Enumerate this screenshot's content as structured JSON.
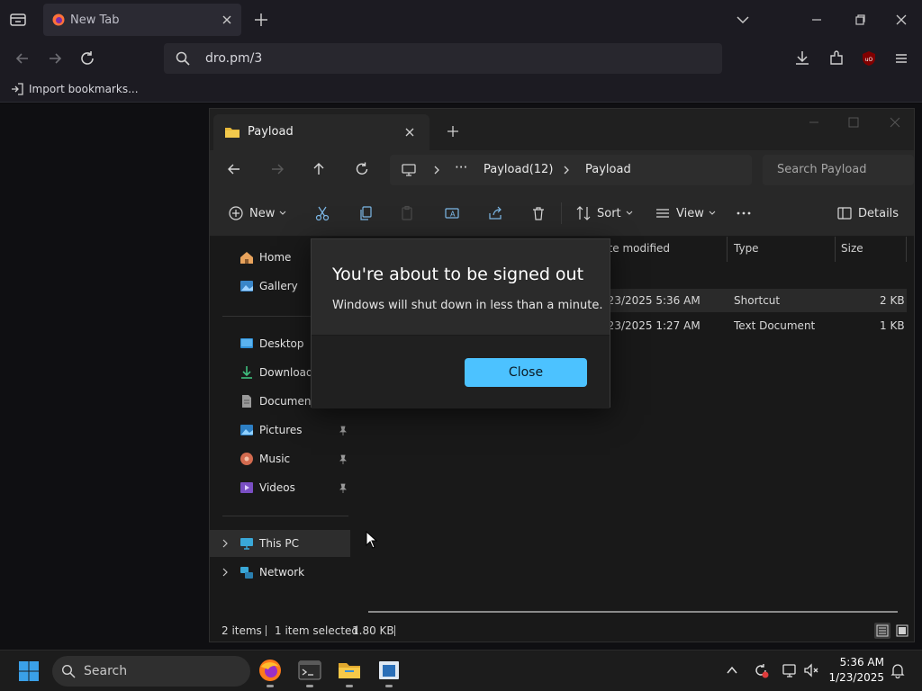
{
  "browser": {
    "tab_title": "New Tab",
    "url": "dro.pm/3",
    "bookmarks_import_label": "Import bookmarks..."
  },
  "explorer": {
    "tab_title": "Payload",
    "breadcrumbs": [
      "Payload(12)",
      "Payload"
    ],
    "search_placeholder": "Search Payload",
    "toolbar": {
      "new_label": "New",
      "sort_label": "Sort",
      "view_label": "View",
      "details_label": "Details"
    },
    "nav": {
      "home": "Home",
      "gallery": "Gallery",
      "desktop": "Desktop",
      "downloads": "Downloads",
      "documents": "Documents",
      "pictures": "Pictures",
      "music": "Music",
      "videos": "Videos",
      "this_pc": "This PC",
      "network": "Network"
    },
    "columns": {
      "date_modified": "Date modified",
      "type": "Type",
      "size": "Size"
    },
    "rows": [
      {
        "date": "1/23/2025 5:36 AM",
        "type": "Shortcut",
        "size": "2 KB"
      },
      {
        "date": "1/23/2025 1:27 AM",
        "type": "Text Document",
        "size": "1 KB"
      }
    ],
    "status": {
      "items": "2 items",
      "selected": "1 item selected",
      "size": "1.80 KB"
    }
  },
  "dialog": {
    "title": "You're about to be signed out",
    "message": "Windows will shut down in less than a minute.",
    "close_label": "Close"
  },
  "taskbar": {
    "search_label": "Search",
    "time": "5:36 AM",
    "date": "1/23/2025"
  },
  "colors": {
    "accent": "#4cc2ff",
    "folder": "#f2c94c"
  }
}
